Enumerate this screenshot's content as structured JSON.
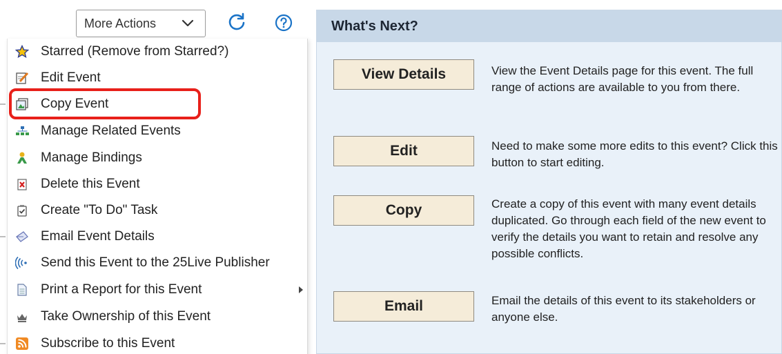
{
  "toolbar": {
    "more_actions_label": "More Actions",
    "refresh_icon": "refresh-icon",
    "help_icon": "help-icon",
    "accent_color": "#1a73c7"
  },
  "menu": {
    "items": [
      {
        "label": "Starred (Remove from Starred?)",
        "icon": "star-icon"
      },
      {
        "label": "Edit Event",
        "icon": "edit-icon"
      },
      {
        "label": "Copy Event",
        "icon": "copy-icon",
        "highlighted": true
      },
      {
        "label": "Manage Related Events",
        "icon": "hierarchy-icon"
      },
      {
        "label": "Manage Bindings",
        "icon": "bindings-icon"
      },
      {
        "label": "Delete this Event",
        "icon": "delete-icon"
      },
      {
        "label": "Create \"To Do\" Task",
        "icon": "todo-icon"
      },
      {
        "label": "Email Event Details",
        "icon": "email-icon"
      },
      {
        "label": "Send this Event to the 25Live Publisher",
        "icon": "broadcast-icon"
      },
      {
        "label": "Print a Report for this Event",
        "icon": "report-icon",
        "has_submenu": true
      },
      {
        "label": "Take Ownership of this Event",
        "icon": "ownership-icon"
      },
      {
        "label": "Subscribe to this Event",
        "icon": "rss-icon"
      }
    ],
    "highlight_color": "#e8201a"
  },
  "whats_next": {
    "title": "What's Next?",
    "actions": [
      {
        "button": "View Details",
        "description": "View the Event Details page for this event. The full range of actions are available to you from there."
      },
      {
        "button": "Edit",
        "description": "Need to make some more edits to this event? Click this button to start editing."
      },
      {
        "button": "Copy",
        "description": "Create a copy of this event with many event details duplicated. Go through each field of the new event to verify the details you want to retain and resolve any possible conflicts."
      },
      {
        "button": "Email",
        "description": "Email the details of this event to its stakeholders or anyone else."
      }
    ]
  }
}
